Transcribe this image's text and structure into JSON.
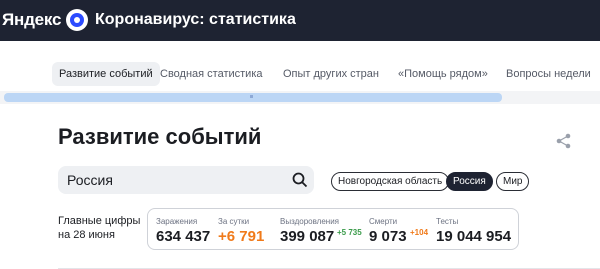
{
  "header": {
    "brand": "Яндекс",
    "logo_icon": "yandex-circle-icon",
    "title": "Коронавирус: статистика",
    "background_color": "#1e2332"
  },
  "tabs": [
    {
      "label": "Развитие событий",
      "active": true
    },
    {
      "label": "Сводная статистика",
      "active": false
    },
    {
      "label": "Опыт других стран",
      "active": false
    },
    {
      "label": "«Помощь рядом»",
      "active": false
    },
    {
      "label": "Вопросы недели",
      "active": false
    }
  ],
  "page": {
    "title": "Развитие событий",
    "share_icon": "share-icon"
  },
  "search": {
    "value": "Россия",
    "icon": "search-icon"
  },
  "region_chips": [
    {
      "label": "Новгородская область",
      "selected": false
    },
    {
      "label": "Россия",
      "selected": true
    },
    {
      "label": "Мир",
      "selected": false
    }
  ],
  "main_figures": {
    "label_line1": "Главные цифры",
    "label_line2": "на 28 июня",
    "stats": [
      {
        "label": "Заражения",
        "value": "634 437",
        "delta": ""
      },
      {
        "label": "За сутки",
        "value": "+6 791",
        "delta": ""
      },
      {
        "label": "Выздоровления",
        "value": "399 087",
        "delta": "+5 735"
      },
      {
        "label": "Смерти",
        "value": "9 073",
        "delta": "+104"
      },
      {
        "label": "Тесты",
        "value": "19 044 954",
        "delta": ""
      }
    ]
  },
  "colors": {
    "accent_orange": "#f07a1a",
    "accent_green": "#3a9b4a",
    "scroll_thumb": "#bcd6f5"
  }
}
